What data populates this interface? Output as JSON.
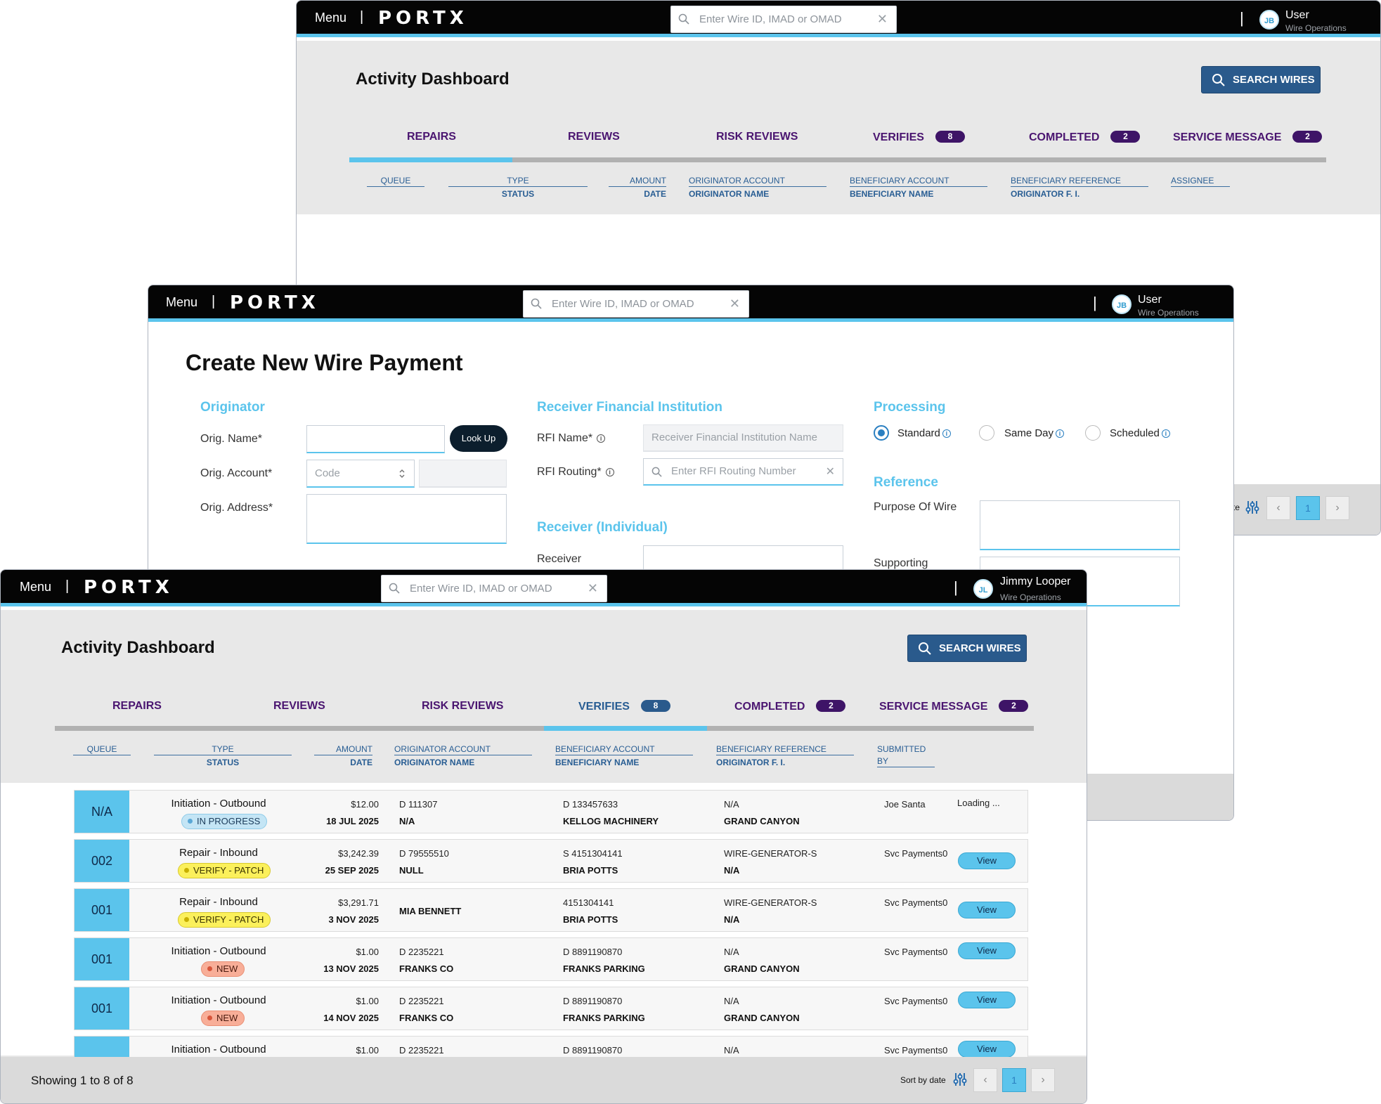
{
  "common": {
    "menu_label": "Menu",
    "brand": "PORT",
    "brand_x": "X",
    "search_placeholder": "Enter Wire ID, IMAD or OMAD",
    "clear_glyph": "✕",
    "bar_separator": "|"
  },
  "back_window": {
    "user_initials": "JB",
    "user_name": "User",
    "user_role": "Wire Operations",
    "title": "Activity Dashboard",
    "search_wires_label": "SEARCH WIRES",
    "tabs": [
      {
        "label": "REPAIRS"
      },
      {
        "label": "REVIEWS"
      },
      {
        "label": "RISK REVIEWS"
      },
      {
        "label": "VERIFIES",
        "badge": "8"
      },
      {
        "label": "COMPLETED",
        "badge": "2"
      },
      {
        "label": "SERVICE MESSAGE",
        "badge": "2"
      }
    ],
    "columns": [
      {
        "l1": "QUEUE",
        "l2": ""
      },
      {
        "l1": "TYPE",
        "l2": "STATUS"
      },
      {
        "l1": "AMOUNT",
        "l2": "DATE"
      },
      {
        "l1": "ORIGINATOR ACCOUNT",
        "l2": "ORIGINATOR NAME"
      },
      {
        "l1": "BENEFICIARY ACCOUNT",
        "l2": "BENEFICIARY NAME"
      },
      {
        "l1": "BENEFICIARY REFERENCE",
        "l2": "ORIGINATOR F. I."
      },
      {
        "l1": "ASSIGNEE",
        "l2": ""
      }
    ],
    "sort_label_partial": "te",
    "page_number": "1"
  },
  "middle_window": {
    "user_initials": "JB",
    "user_name": "User",
    "user_role": "Wire Operations",
    "title": "Create New Wire Payment",
    "originator": {
      "section": "Originator",
      "name_label": "Orig. Name*",
      "lookup_label": "Look Up",
      "account_label": "Orig. Account*",
      "account_code_placeholder": "Code",
      "address_label": "Orig. Address*"
    },
    "rfi": {
      "section": "Receiver Financial Institution",
      "name_label": "RFI Name*",
      "name_placeholder": "Receiver Financial Institution Name",
      "routing_label": "RFI Routing*",
      "routing_placeholder": "Enter RFI Routing Number"
    },
    "receiver": {
      "section": "Receiver (Individual)",
      "label": "Receiver"
    },
    "processing": {
      "section": "Processing",
      "options": [
        "Standard",
        "Same Day",
        "Scheduled"
      ],
      "selected": "Standard"
    },
    "reference": {
      "section": "Reference",
      "purpose_label": "Purpose Of Wire",
      "supporting_label": "Supporting"
    }
  },
  "front_window": {
    "user_initials": "JL",
    "user_name": "Jimmy Looper",
    "user_role": "Wire Operations",
    "title": "Activity Dashboard",
    "search_wires_label": "SEARCH WIRES",
    "tabs": [
      {
        "label": "REPAIRS"
      },
      {
        "label": "REVIEWS"
      },
      {
        "label": "RISK REVIEWS"
      },
      {
        "label": "VERIFIES",
        "badge": "8",
        "active": true
      },
      {
        "label": "COMPLETED",
        "badge": "2"
      },
      {
        "label": "SERVICE MESSAGE",
        "badge": "2"
      }
    ],
    "columns": [
      {
        "l1": "QUEUE",
        "l2": ""
      },
      {
        "l1": "TYPE",
        "l2": "STATUS"
      },
      {
        "l1": "AMOUNT",
        "l2": "DATE"
      },
      {
        "l1": "ORIGINATOR ACCOUNT",
        "l2": "ORIGINATOR NAME"
      },
      {
        "l1": "BENEFICIARY ACCOUNT",
        "l2": "BENEFICIARY NAME"
      },
      {
        "l1": "BENEFICIARY REFERENCE",
        "l2": "ORIGINATOR F. I."
      },
      {
        "l1": "SUBMITTED",
        "l2": "BY"
      }
    ],
    "rows": [
      {
        "queue": "N/A",
        "type": "Initiation  -  Outbound",
        "status": "IN PROGRESS",
        "status_kind": "progress",
        "amount": "$12.00",
        "date": "18 JUL 2025",
        "orig_acct": "D 111307",
        "orig_name": "N/A",
        "ben_acct": "D 133457633",
        "ben_name": "KELLOG MACHINERY",
        "ben_ref": "N/A",
        "orig_fi": "GRAND CANYON",
        "submitted_by": "Joe Santa",
        "action": "Loading ..."
      },
      {
        "queue": "002",
        "type": "Repair  -  Inbound",
        "status": "VERIFY - PATCH",
        "status_kind": "verify",
        "amount": "$3,242.39",
        "date": "25 SEP 2025",
        "orig_acct": "D 79555510",
        "orig_name": "NULL",
        "ben_acct": "S 4151304141",
        "ben_name": "BRIA POTTS",
        "ben_ref": "WIRE-GENERATOR-S",
        "orig_fi": "N/A",
        "submitted_by": "Svc Payments0",
        "action": "View"
      },
      {
        "queue": "001",
        "type": "Repair  -  Inbound",
        "status": "VERIFY - PATCH",
        "status_kind": "verify",
        "amount": "$3,291.71",
        "date": "3 NOV 2025",
        "orig_acct": "",
        "orig_name": "MIA BENNETT",
        "ben_acct": "4151304141",
        "ben_name": "BRIA POTTS",
        "ben_ref": "WIRE-GENERATOR-S",
        "orig_fi": "N/A",
        "submitted_by": "Svc Payments0",
        "action": "View"
      },
      {
        "queue": "001",
        "type": "Initiation  -  Outbound",
        "status": "NEW",
        "status_kind": "new",
        "amount": "$1.00",
        "date": "13 NOV 2025",
        "orig_acct": "D 2235221",
        "orig_name": "FRANKS CO",
        "ben_acct": "D 8891190870",
        "ben_name": "FRANKS PARKING",
        "ben_ref": "N/A",
        "orig_fi": "GRAND CANYON",
        "submitted_by": "Svc Payments0",
        "action": "View"
      },
      {
        "queue": "001",
        "type": "Initiation  -  Outbound",
        "status": "NEW",
        "status_kind": "new",
        "amount": "$1.00",
        "date": "14 NOV 2025",
        "orig_acct": "D 2235221",
        "orig_name": "FRANKS CO",
        "ben_acct": "D 8891190870",
        "ben_name": "FRANKS PARKING",
        "ben_ref": "N/A",
        "orig_fi": "GRAND CANYON",
        "submitted_by": "Svc Payments0",
        "action": "View"
      },
      {
        "queue": "",
        "type": "Initiation  -  Outbound",
        "status": "",
        "status_kind": "",
        "amount": "$1.00",
        "date": "",
        "orig_acct": "D 2235221",
        "orig_name": "",
        "ben_acct": "D 8891190870",
        "ben_name": "",
        "ben_ref": "N/A",
        "orig_fi": "",
        "submitted_by": "Svc Payments0",
        "action": "View"
      }
    ],
    "showing": "Showing 1 to 8 of 8",
    "sort_label": "Sort by date",
    "page_number": "1",
    "prev_glyph": "‹",
    "next_glyph": "›"
  },
  "colors": {
    "accent": "#5bc4ec",
    "nav_bar": "#050505",
    "primary_button": "#2a5a8c",
    "tab_text": "#4a1570",
    "badge": "#3e1467"
  }
}
